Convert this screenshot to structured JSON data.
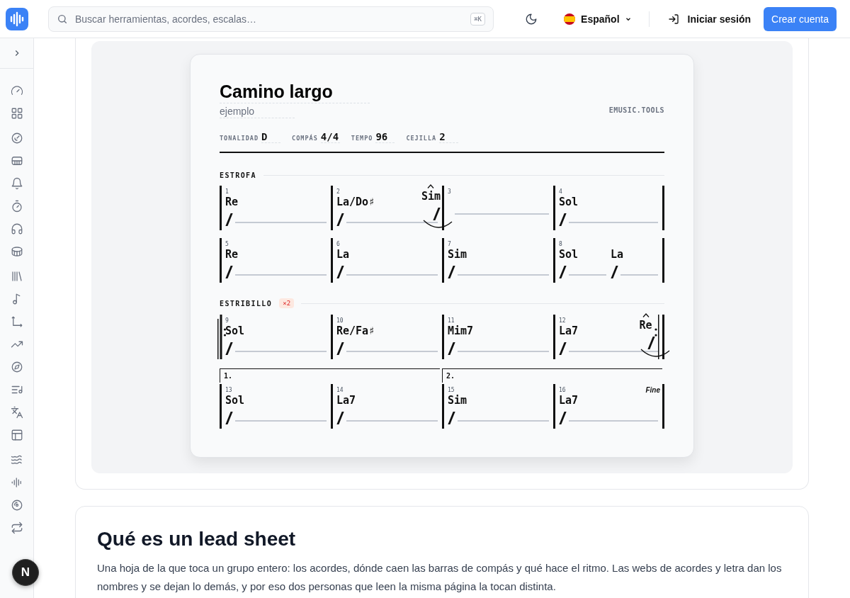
{
  "topbar": {
    "search": {
      "placeholder": "Buscar herramientas, acordes, escalas…",
      "shortcut": "⌘K"
    },
    "language": "Español",
    "login": "Iniciar sesión",
    "signup": "Crear cuenta"
  },
  "sheet": {
    "title": "Camino largo",
    "subtitle": "ejemplo",
    "brand": "EMUSIC.TOOLS",
    "meta": [
      {
        "label": "TONALIDAD",
        "value": "D"
      },
      {
        "label": "COMPÁS",
        "value": "4/4"
      },
      {
        "label": "TEMPO",
        "value": "96"
      },
      {
        "label": "CEJILLA",
        "value": "2"
      }
    ],
    "sections": [
      {
        "name": "ESTROFA",
        "rows": [
          [
            {
              "number": "1",
              "kind": "plain",
              "chords": [
                {
                  "name": "Re",
                  "kind": "beat"
                }
              ]
            },
            {
              "number": "2",
              "kind": "plain",
              "chords": [
                {
                  "name": "La/Do♯",
                  "kind": "beat"
                },
                {
                  "name": "Sim",
                  "kind": "push"
                }
              ]
            },
            {
              "number": "3",
              "kind": "plain"
            },
            {
              "number": "4",
              "kind": "plain",
              "chords": [
                {
                  "name": "Sol",
                  "kind": "beat"
                }
              ]
            }
          ],
          [
            {
              "number": "5",
              "kind": "plain",
              "chords": [
                {
                  "name": "Re",
                  "kind": "beat"
                }
              ]
            },
            {
              "number": "6",
              "kind": "plain",
              "chords": [
                {
                  "name": "La",
                  "kind": "beat"
                }
              ]
            },
            {
              "number": "7",
              "kind": "plain",
              "chords": [
                {
                  "name": "Sim",
                  "kind": "beat"
                }
              ]
            },
            {
              "number": "8",
              "kind": "plain",
              "chords": [
                {
                  "name": "Sol",
                  "kind": "beat"
                },
                {
                  "name": "La",
                  "kind": "beat"
                }
              ]
            }
          ]
        ]
      },
      {
        "name": "ESTRIBILLO",
        "badge": "×2",
        "rows": [
          [
            {
              "number": "9",
              "kind": "repeat_start",
              "chords": [
                {
                  "name": "Sol",
                  "kind": "beat"
                }
              ]
            },
            {
              "number": "10",
              "kind": "plain",
              "chords": [
                {
                  "name": "Re/Fa♯",
                  "kind": "beat"
                }
              ]
            },
            {
              "number": "11",
              "kind": "plain",
              "chords": [
                {
                  "name": "Mim7",
                  "kind": "beat"
                }
              ]
            },
            {
              "number": "12",
              "kind": "repeat_end",
              "chords": [
                {
                  "name": "La7",
                  "kind": "beat"
                },
                {
                  "name": "Re",
                  "kind": "push"
                }
              ]
            }
          ],
          [
            {
              "number": "13",
              "kind": "plain",
              "ending": "1.",
              "chords": [
                {
                  "name": "Sol",
                  "kind": "beat"
                }
              ]
            },
            {
              "number": "14",
              "kind": "plain",
              "chords": [
                {
                  "name": "La7",
                  "kind": "beat"
                }
              ]
            },
            {
              "number": "15",
              "kind": "plain",
              "ending": "2.",
              "chords": [
                {
                  "name": "Sim",
                  "kind": "beat"
                }
              ]
            },
            {
              "number": "16",
              "kind": "plain",
              "mark": "Fine",
              "chords": [
                {
                  "name": "La7",
                  "kind": "beat"
                }
              ]
            }
          ]
        ]
      }
    ]
  },
  "article": {
    "heading": "Qué es un lead sheet",
    "body": "Una hoja de la que toca un grupo entero: los acordes, dónde caen las barras de compás y qué hace el ritmo. Las webs de acordes y letra dan los nombres y se dejan lo demás, y por eso dos personas que leen la misma página la tocan distinta."
  },
  "dev_badge": "N"
}
